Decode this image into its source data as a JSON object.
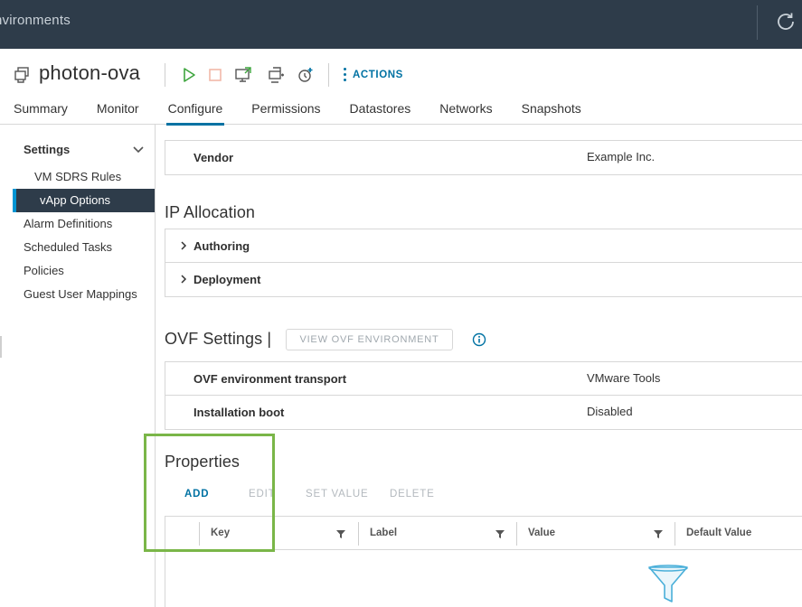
{
  "topbar": {
    "breadcrumb": "nvironments"
  },
  "object": {
    "name": "photon-ova",
    "actions_label": "ACTIONS"
  },
  "tabs": [
    {
      "label": "Summary"
    },
    {
      "label": "Monitor"
    },
    {
      "label": "Configure"
    },
    {
      "label": "Permissions"
    },
    {
      "label": "Datastores"
    },
    {
      "label": "Networks"
    },
    {
      "label": "Snapshots"
    }
  ],
  "sidebar": {
    "section": "Settings",
    "items": [
      {
        "label": "VM SDRS Rules"
      },
      {
        "label": "vApp Options"
      },
      {
        "label": "Alarm Definitions"
      },
      {
        "label": "Scheduled Tasks"
      },
      {
        "label": "Policies"
      },
      {
        "label": "Guest User Mappings"
      }
    ]
  },
  "content": {
    "product": {
      "key": "Vendor",
      "value": "Example Inc."
    },
    "ip_allocation": {
      "title": "IP Allocation",
      "rows": [
        {
          "label": "Authoring"
        },
        {
          "label": "Deployment"
        }
      ]
    },
    "ovf": {
      "title": "OVF Settings",
      "title_sep": "|",
      "button": "VIEW OVF ENVIRONMENT",
      "rows": [
        {
          "key": "OVF environment transport",
          "value": "VMware Tools"
        },
        {
          "key": "Installation boot",
          "value": "Disabled"
        }
      ]
    },
    "properties": {
      "title": "Properties",
      "buttons": {
        "add": "ADD",
        "edit": "EDIT",
        "set_value": "SET VALUE",
        "delete": "DELETE"
      },
      "columns": [
        {
          "label": "Key"
        },
        {
          "label": "Label"
        },
        {
          "label": "Value"
        },
        {
          "label": "Default Value"
        }
      ]
    }
  },
  "colors": {
    "accent": "#0072a3",
    "header_bg": "#2e3c4a",
    "highlight": "#7ab648",
    "play": "#3ea53e",
    "stop": "#e14b2e"
  },
  "icons": [
    "refresh-icon",
    "vm-icon",
    "power-on-icon",
    "power-off-icon",
    "console-icon",
    "migrate-icon",
    "snapshot-icon",
    "chevron-down-icon",
    "chevron-right-icon",
    "info-icon",
    "filter-icon",
    "empty-filter-icon"
  ]
}
